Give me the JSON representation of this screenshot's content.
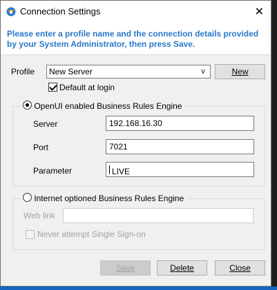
{
  "window": {
    "title": "Connection Settings",
    "close_glyph": "✕",
    "icon": "app-globe-icon"
  },
  "instruction": "Please enter a profile name and the connection details provided by your System Administrator, then press Save.",
  "profile": {
    "label": "Profile",
    "selected": "New Server",
    "new_button_label": "New",
    "default_checkbox_label": "Default at login",
    "default_checked": true
  },
  "openui": {
    "radio_label": "OpenUI enabled Business Rules Engine",
    "selected": true,
    "server_label": "Server",
    "server_value": "192.168.16.30",
    "port_label": "Port",
    "port_value": "7021",
    "parameter_label": "Parameter",
    "parameter_value": "LIVE"
  },
  "internet": {
    "radio_label": "Internet optioned Business Rules Engine",
    "selected": false,
    "weblink_label": "Web link",
    "weblink_value": "",
    "sso_label": "Never attempt Single Sign-on",
    "sso_checked": false
  },
  "buttons": {
    "save_label": "Save",
    "save_enabled": false,
    "delete_label": "Delete",
    "close_label": "Close"
  },
  "colors": {
    "instruction_text": "#2a78c8",
    "taskbar": "#1565c0"
  }
}
